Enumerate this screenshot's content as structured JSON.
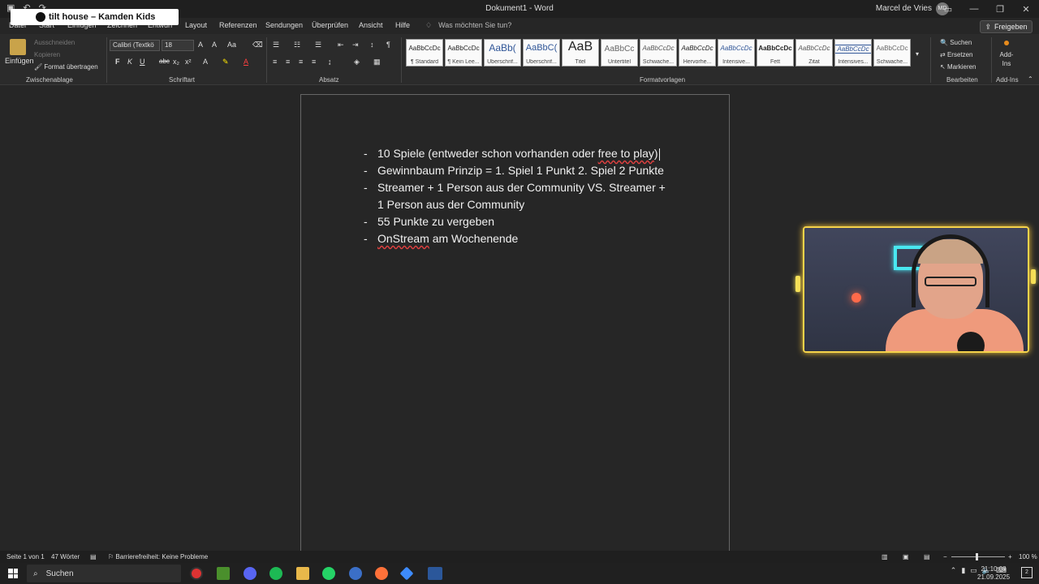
{
  "overlay": {
    "banner": "tilt house – Kamden Kids"
  },
  "window": {
    "title": "Dokument1 - Word",
    "user": "Marcel de Vries",
    "user_initials": "MD"
  },
  "tabs": [
    {
      "label": "Datei"
    },
    {
      "label": "Start"
    },
    {
      "label": "Einfügen"
    },
    {
      "label": "Zeichnen"
    },
    {
      "label": "Entwurf"
    },
    {
      "label": "Layout"
    },
    {
      "label": "Referenzen"
    },
    {
      "label": "Sendungen"
    },
    {
      "label": "Überprüfen"
    },
    {
      "label": "Ansicht"
    },
    {
      "label": "Hilfe"
    }
  ],
  "tell_me": "Was möchten Sie tun?",
  "share": "Freigeben",
  "ribbon": {
    "clipboard": {
      "paste": "Einfügen",
      "cut": "Ausschneiden",
      "copy": "Kopieren",
      "format_painter": "Format übertragen",
      "label": "Zwischenablage"
    },
    "font": {
      "name": "Calibri (Textkö",
      "size": "18",
      "bold": "F",
      "italic": "K",
      "underline": "U",
      "strike": "abc",
      "label": "Schriftart"
    },
    "paragraph": {
      "label": "Absatz"
    },
    "styles": {
      "label": "Formatvorlagen",
      "items": [
        {
          "preview": "AaBbCcDc",
          "name": "¶ Standard"
        },
        {
          "preview": "AaBbCcDc",
          "name": "¶ Kein Lee..."
        },
        {
          "preview": "AaBb(",
          "name": "Überschrif..."
        },
        {
          "preview": "AaBbC(",
          "name": "Überschrif..."
        },
        {
          "preview": "AaB",
          "name": "Titel"
        },
        {
          "preview": "AaBbCc",
          "name": "Untertitel"
        },
        {
          "preview": "AaBbCcDc",
          "name": "Schwache..."
        },
        {
          "preview": "AaBbCcDc",
          "name": "Hervorhe..."
        },
        {
          "preview": "AaBbCcDc",
          "name": "Intensive..."
        },
        {
          "preview": "AaBbCcDc",
          "name": "Fett"
        },
        {
          "preview": "AaBbCcDc",
          "name": "Zitat"
        },
        {
          "preview": "AaBbCcDc",
          "name": "Intensives..."
        },
        {
          "preview": "AaBbCcDc",
          "name": "Schwache..."
        }
      ]
    },
    "editing": {
      "find": "Suchen",
      "replace": "Ersetzen",
      "select": "Markieren",
      "label": "Bearbeiten"
    },
    "addins": {
      "button": "Add-Ins",
      "label": "Add-Ins"
    }
  },
  "document": {
    "bullets": [
      {
        "text": "10 Spiele (entweder schon vorhanden oder ",
        "flag": "free to play",
        "tail": ")"
      },
      {
        "text": "Gewinnbaum Prinzip = 1. Spiel 1 Punkt 2. Spiel 2 Punkte"
      },
      {
        "text": "Streamer + 1 Person aus der Community VS. Streamer + 1 Person aus der Community"
      },
      {
        "text": "55 Punkte zu vergeben"
      },
      {
        "flag": "OnStream",
        "text": " am Wochenende"
      }
    ]
  },
  "status": {
    "page": "Seite 1 von 1",
    "words": "47 Wörter",
    "accessibility": "Barrierefreiheit: Keine Probleme",
    "zoom": "100 %"
  },
  "taskbar": {
    "search": "Suchen",
    "time": "21:10:08",
    "date": "21.09.2025",
    "notifications": "2"
  },
  "colors": {
    "accent": "#f5d34a",
    "cam_led": "#49e7f0",
    "page_border": "#666666"
  }
}
